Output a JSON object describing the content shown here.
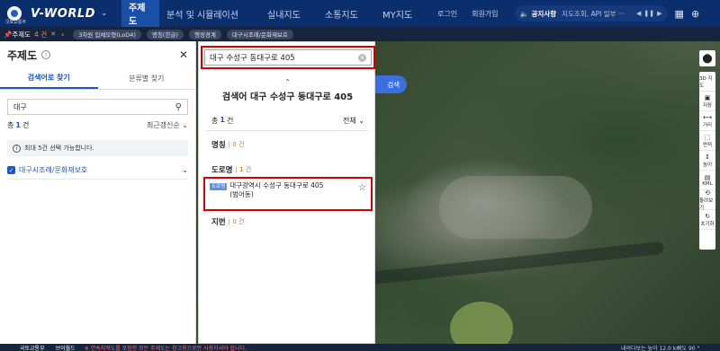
{
  "header": {
    "logo_sub": "국토교통부",
    "logo_text": "V-WORLD",
    "nav": [
      "주제도",
      "분석 및 시뮬레이션",
      "실내지도",
      "소통지도",
      "MY지도"
    ],
    "login": "로그인",
    "signup": "회원가입",
    "notice_title": "공지사항",
    "notice_text": "지도조회, API 일부 ···"
  },
  "themebar": {
    "label": "주제도",
    "count": "4 건",
    "chips": [
      "3차원 입체모형(LoD4)",
      "명칭(한글)",
      "행정경계",
      "대구시조례/문화재보호"
    ]
  },
  "left_panel": {
    "title": "주제도",
    "tabs": [
      "검색어로 찾기",
      "분류별 찾기"
    ],
    "search_value": "대구",
    "total_prefix": "총",
    "total_count": "1",
    "total_suffix": "건",
    "sort": "최근갱신순",
    "info": "최대 5건 선택 가능합니다.",
    "item": "대구시조례/문화재보호"
  },
  "search_dropdown": {
    "input_value": "대구 수성구 동대구로 405",
    "heading": "검색어 대구 수성구 동대구로 405",
    "total_prefix": "총",
    "total_count": "1",
    "total_suffix": "건",
    "filter": "전체",
    "cat_name": "명칭",
    "cat_name_count": "0",
    "cat_road": "도로명",
    "cat_road_count": "1",
    "cat_lot": "지번",
    "cat_lot_count": "0",
    "count_unit": "건",
    "result_badge": "도로명",
    "result_line1": "대구광역시 수성구 동대구로 405",
    "result_line2": "(범어동)"
  },
  "map": {
    "search_button": "검색"
  },
  "toolbar": [
    "3D 지도",
    "저장",
    "거리",
    "면적",
    "높이",
    "KML",
    "돌려보기",
    "초기화"
  ],
  "status": {
    "logo": "국토교통부",
    "brand": "브이월드",
    "warning": "※ 연속지적도를 포함한 모든 주제도는 참고용으로만 사용하셔야 합니다.",
    "altitude": "내려다보는 높이 12.0 km",
    "tilt": "각도 90 °"
  }
}
